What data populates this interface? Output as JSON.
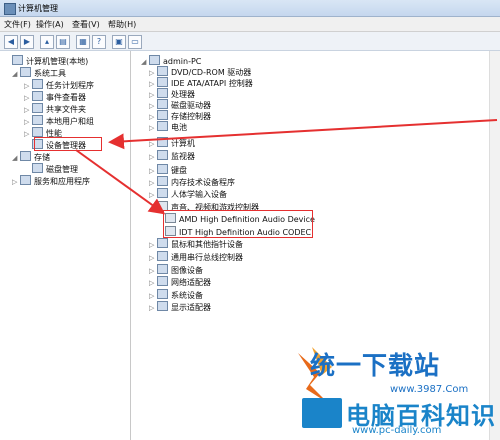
{
  "window": {
    "title": "计算机管理"
  },
  "menu": [
    "文件(F)",
    "操作(A)",
    "查看(V)",
    "帮助(H)"
  ],
  "left_tree": [
    {
      "label": "计算机管理(本地)",
      "level": 0,
      "expand": ""
    },
    {
      "label": "系统工具",
      "level": 1,
      "expand": "◢"
    },
    {
      "label": "任务计划程序",
      "level": 2,
      "expand": "▷"
    },
    {
      "label": "事件查看器",
      "level": 2,
      "expand": "▷"
    },
    {
      "label": "共享文件夹",
      "level": 2,
      "expand": "▷"
    },
    {
      "label": "本地用户和组",
      "level": 2,
      "expand": "▷"
    },
    {
      "label": "性能",
      "level": 2,
      "expand": "▷"
    },
    {
      "label": "设备管理器",
      "level": 2,
      "expand": ""
    },
    {
      "label": "存储",
      "level": 1,
      "expand": "◢"
    },
    {
      "label": "磁盘管理",
      "level": 2,
      "expand": ""
    },
    {
      "label": "服务和应用程序",
      "level": 1,
      "expand": "▷"
    }
  ],
  "right_tree": [
    {
      "label": "admin-PC",
      "level": 0,
      "expand": "◢"
    },
    {
      "label": "DVD/CD-ROM 驱动器",
      "level": 1,
      "expand": "▷"
    },
    {
      "label": "IDE ATA/ATAPI 控制器",
      "level": 1,
      "expand": "▷"
    },
    {
      "label": "处理器",
      "level": 1,
      "expand": "▷"
    },
    {
      "label": "磁盘驱动器",
      "level": 1,
      "expand": "▷"
    },
    {
      "label": "存储控制器",
      "level": 1,
      "expand": "▷"
    },
    {
      "label": "电池",
      "level": 1,
      "expand": "▷"
    },
    {
      "label": "计算机",
      "level": 1,
      "expand": "▷"
    },
    {
      "label": "监视器",
      "level": 1,
      "expand": "▷"
    },
    {
      "label": "键盘",
      "level": 1,
      "expand": "▷"
    },
    {
      "label": "内存技术设备程序",
      "level": 1,
      "expand": "▷"
    },
    {
      "label": "人体学输入设备",
      "level": 1,
      "expand": "▷"
    },
    {
      "label": "声音、视频和游戏控制器",
      "level": 1,
      "expand": "◢"
    },
    {
      "label": "AMD High Definition Audio Device",
      "level": 2,
      "expand": ""
    },
    {
      "label": "IDT High Definition Audio CODEC",
      "level": 2,
      "expand": ""
    },
    {
      "label": "鼠标和其他指针设备",
      "level": 1,
      "expand": "▷"
    },
    {
      "label": "通用串行总线控制器",
      "level": 1,
      "expand": "▷"
    },
    {
      "label": "图像设备",
      "level": 1,
      "expand": "▷"
    },
    {
      "label": "网络适配器",
      "level": 1,
      "expand": "▷"
    },
    {
      "label": "系统设备",
      "level": 1,
      "expand": "▷"
    },
    {
      "label": "显示适配器",
      "level": 1,
      "expand": "▷"
    }
  ],
  "watermark": {
    "brand1": "统一下载站",
    "brand1_url": "www.3987.Com",
    "brand2": "电脑百科知识",
    "brand2_url": "www.pc-daily.com"
  }
}
